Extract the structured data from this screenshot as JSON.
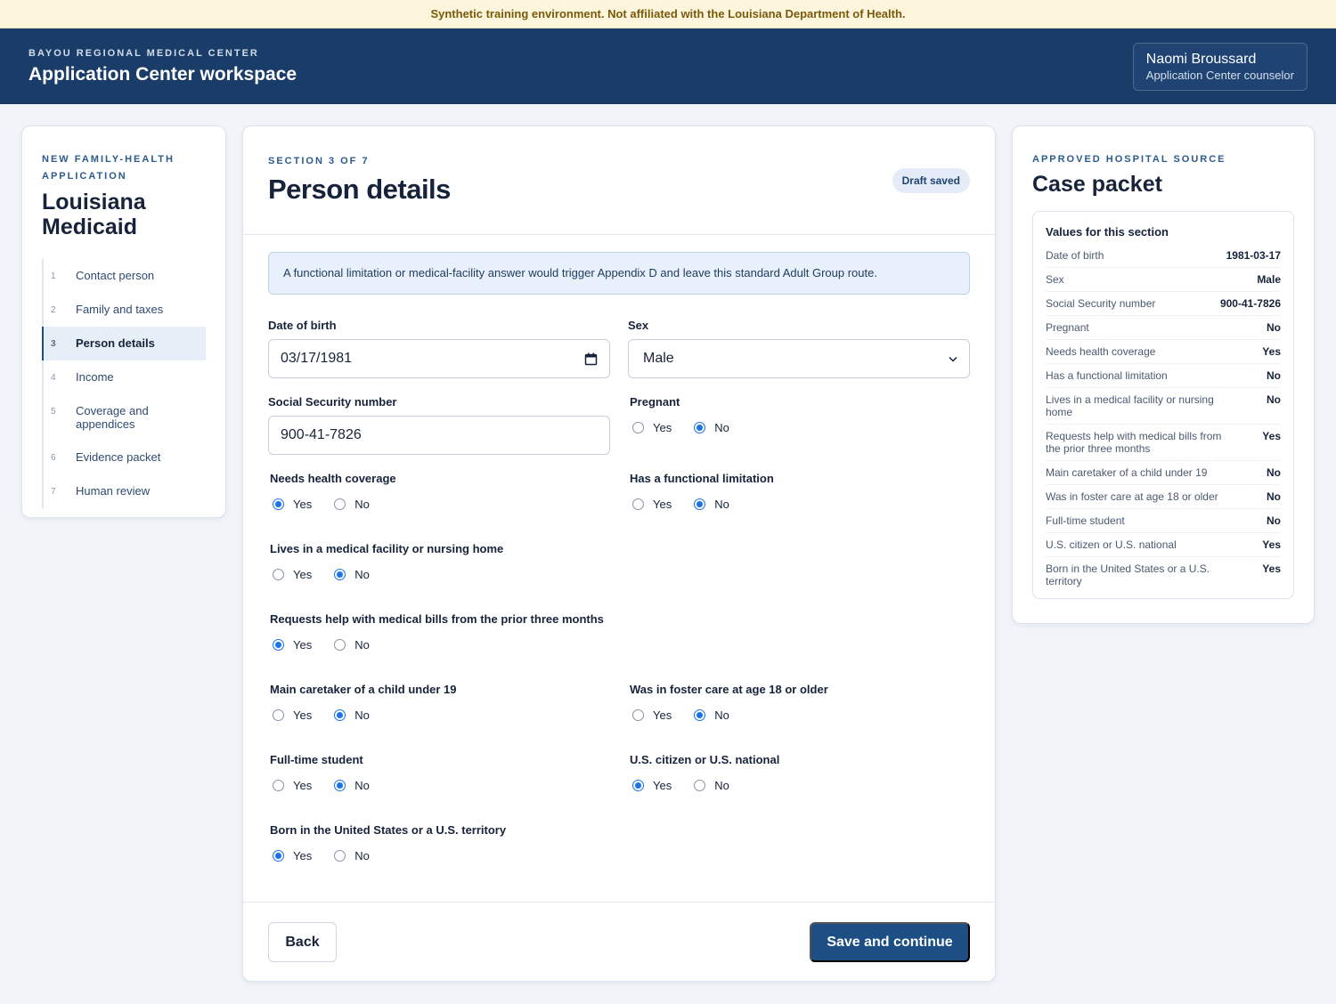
{
  "banner": "Synthetic training environment. Not affiliated with the Louisiana Department of Health.",
  "header": {
    "eyebrow": "BAYOU REGIONAL MEDICAL CENTER",
    "title": "Application Center workspace",
    "user_name": "Naomi Broussard",
    "user_role": "Application Center counselor"
  },
  "nav": {
    "eyebrow": "NEW FAMILY-HEALTH APPLICATION",
    "title": "Louisiana Medicaid",
    "steps": [
      {
        "num": "1",
        "label": "Contact person"
      },
      {
        "num": "2",
        "label": "Family and taxes"
      },
      {
        "num": "3",
        "label": "Person details"
      },
      {
        "num": "4",
        "label": "Income"
      },
      {
        "num": "5",
        "label": "Coverage and appendices"
      },
      {
        "num": "6",
        "label": "Evidence packet"
      },
      {
        "num": "7",
        "label": "Human review"
      }
    ]
  },
  "main": {
    "section": "SECTION 3 OF 7",
    "title": "Person details",
    "badge": "Draft saved",
    "notice": "A functional limitation or medical-facility answer would trigger Appendix D and leave this standard Adult Group route.",
    "dob": {
      "label": "Date of birth",
      "value": "03/17/1981"
    },
    "sex": {
      "label": "Sex",
      "value": "Male"
    },
    "ssn": {
      "label": "Social Security number",
      "value": "900-41-7826"
    },
    "yes": "Yes",
    "no": "No",
    "questions": {
      "pregnant": {
        "label": "Pregnant",
        "value": "No"
      },
      "needs_coverage": {
        "label": "Needs health coverage",
        "value": "Yes"
      },
      "functional_limitation": {
        "label": "Has a functional limitation",
        "value": "No"
      },
      "medical_facility": {
        "label": "Lives in a medical facility or nursing home",
        "value": "No"
      },
      "prior_bills": {
        "label": "Requests help with medical bills from the prior three months",
        "value": "Yes"
      },
      "caretaker": {
        "label": "Main caretaker of a child under 19",
        "value": "No"
      },
      "foster_care": {
        "label": "Was in foster care at age 18 or older",
        "value": "No"
      },
      "student": {
        "label": "Full-time student",
        "value": "No"
      },
      "citizen": {
        "label": "U.S. citizen or U.S. national",
        "value": "Yes"
      },
      "born_us": {
        "label": "Born in the United States or a U.S. territory",
        "value": "Yes"
      }
    },
    "back_label": "Back",
    "save_label": "Save and continue"
  },
  "packet": {
    "eyebrow": "APPROVED HOSPITAL SOURCE",
    "title": "Case packet",
    "box_title": "Values for this section",
    "rows": [
      {
        "k": "Date of birth",
        "v": "1981-03-17"
      },
      {
        "k": "Sex",
        "v": "Male"
      },
      {
        "k": "Social Security number",
        "v": "900-41-7826"
      },
      {
        "k": "Pregnant",
        "v": "No"
      },
      {
        "k": "Needs health coverage",
        "v": "Yes"
      },
      {
        "k": "Has a functional limitation",
        "v": "No"
      },
      {
        "k": "Lives in a medical facility or nursing home",
        "v": "No"
      },
      {
        "k": "Requests help with medical bills from the prior three months",
        "v": "Yes"
      },
      {
        "k": "Main caretaker of a child under 19",
        "v": "No"
      },
      {
        "k": "Was in foster care at age 18 or older",
        "v": "No"
      },
      {
        "k": "Full-time student",
        "v": "No"
      },
      {
        "k": "U.S. citizen or U.S. national",
        "v": "Yes"
      },
      {
        "k": "Born in the United States or a U.S. territory",
        "v": "Yes"
      }
    ]
  },
  "colors": {
    "primary": "#1d4f85",
    "header": "#193d68",
    "radio_selected": "#1a73e8"
  }
}
